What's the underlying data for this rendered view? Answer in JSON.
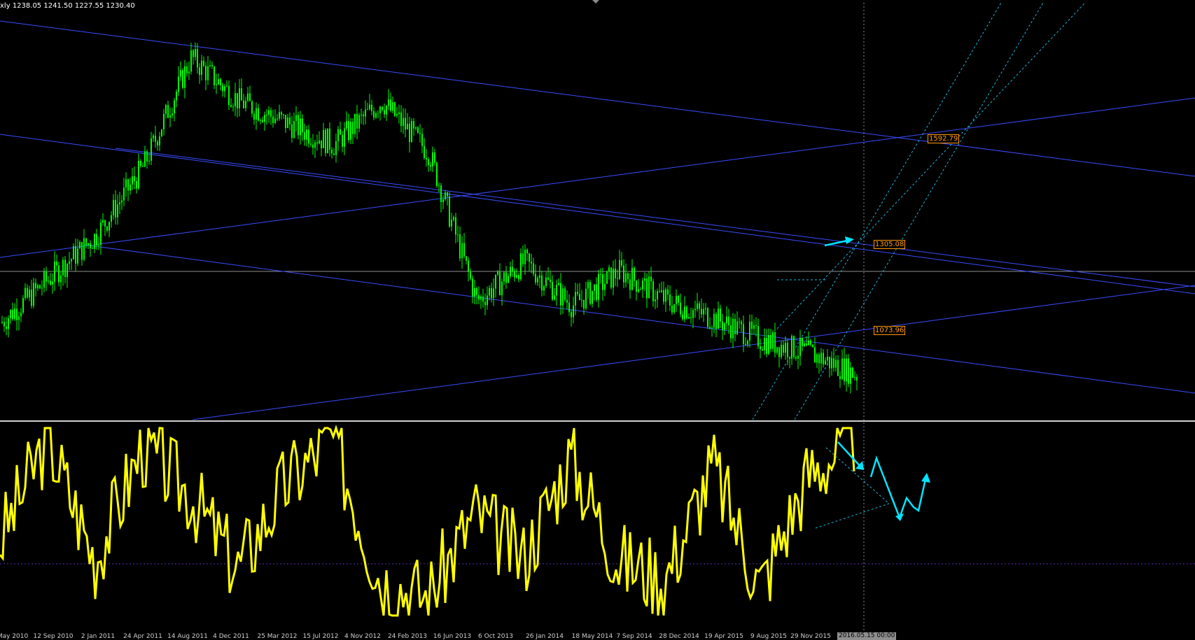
{
  "header": {
    "symbol": "xly",
    "ohlc_text": "1238.05 1241.50 1227.55 1230.40"
  },
  "price_levels": [
    {
      "value": "1592.79"
    },
    {
      "value": "1305.08"
    },
    {
      "value": "1073.96"
    }
  ],
  "crosshair_time": "2016.05.15 00:00",
  "colors": {
    "background": "#000000",
    "candle": "#00ff00",
    "trendline": "#3a4bff",
    "channel": "#1fb4d8",
    "oscillator": "#ffff00",
    "arrow": "#00e5ff",
    "price_tag": "#ff9900",
    "separator": "#cfcfcf"
  },
  "chart_data": [
    {
      "type": "line",
      "title": "",
      "description_of_series": "weekly price candles (approximate close values)",
      "x": [
        "May 2010",
        "12 Sep 2010",
        "2 Jan 2011",
        "24 Apr 2011",
        "14 Aug 2011",
        "4 Dec 2011",
        "25 Mar 2012",
        "15 Jul 2012",
        "4 Nov 2012",
        "24 Feb 2013",
        "16 Jun 2013",
        "6 Oct 2013",
        "26 Jan 2014",
        "18 May 2014",
        "7 Sep 2014",
        "28 Dec 2014",
        "19 Apr 2015",
        "9 Aug 2015",
        "29 Nov 2015"
      ],
      "series": [
        {
          "name": "",
          "values": [
            1190,
            1290,
            1390,
            1550,
            1800,
            1700,
            1650,
            1600,
            1700,
            1580,
            1240,
            1330,
            1230,
            1310,
            1240,
            1200,
            1150,
            1120,
            1070
          ]
        }
      ],
      "price_levels": [
        1592.79,
        1305.08,
        1073.96
      ]
    },
    {
      "type": "line",
      "title": "",
      "description_of_series": "oscillator sub-window",
      "x": [
        "May 2010",
        "12 Sep 2010",
        "2 Jan 2011",
        "24 Apr 2011",
        "14 Aug 2011",
        "4 Dec 2011",
        "25 Mar 2012",
        "15 Jul 2012",
        "4 Nov 2012",
        "24 Feb 2013",
        "16 Jun 2013",
        "6 Oct 2013",
        "26 Jan 2014",
        "18 May 2014",
        "7 Sep 2014",
        "28 Dec 2014",
        "19 Apr 2015",
        "9 Aug 2015",
        "29 Nov 2015"
      ],
      "series": [
        {
          "name": "",
          "values": [
            40,
            95,
            30,
            90,
            65,
            25,
            70,
            95,
            20,
            10,
            55,
            30,
            85,
            30,
            20,
            80,
            15,
            75,
            95
          ]
        }
      ]
    }
  ],
  "x_axis_ticks": [
    "May 2010",
    "12 Sep 2010",
    "2 Jan 2011",
    "24 Apr 2011",
    "14 Aug 2011",
    "4 Dec 2011",
    "25 Mar 2012",
    "15 Jul 2012",
    "4 Nov 2012",
    "24 Feb 2013",
    "16 Jun 2013",
    "6 Oct 2013",
    "26 Jan 2014",
    "18 May 2014",
    "7 Sep 2014",
    "28 Dec 2014",
    "19 Apr 2015",
    "9 Aug 2015",
    "29 Nov 2015"
  ]
}
